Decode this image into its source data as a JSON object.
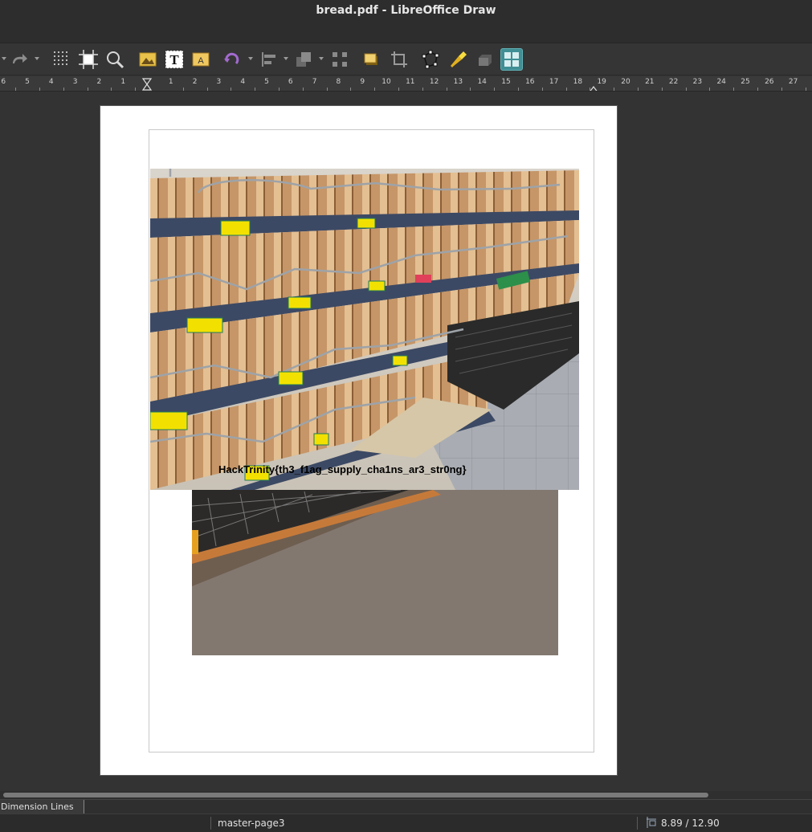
{
  "window": {
    "title": "bread.pdf - LibreOffice Draw"
  },
  "toolbar": {
    "items": [
      "redo-icon",
      "grid-icon",
      "helplines-icon",
      "zoom-icon",
      "image-icon",
      "text-box-icon",
      "fontwork-icon",
      "rotate-icon",
      "align-icon",
      "arrange-icon",
      "distribute-icon",
      "shadow-icon",
      "crop-icon",
      "points-icon",
      "glue-points-icon",
      "toggle-extrusion-icon",
      "display-views-icon"
    ]
  },
  "ruler": {
    "labels": [
      "6",
      "5",
      "4",
      "3",
      "2",
      "1",
      "1",
      "2",
      "3",
      "4",
      "5",
      "6",
      "7",
      "8",
      "9",
      "10",
      "11",
      "12",
      "13",
      "14",
      "15",
      "16",
      "17",
      "18",
      "19",
      "20",
      "21",
      "22",
      "23",
      "24",
      "25",
      "26",
      "27"
    ]
  },
  "document": {
    "flag_text": "HackTrinity{th3_f1ag_supply_cha1ns_ar3_str0ng}"
  },
  "tabs": {
    "active": "Dimension Lines"
  },
  "statusbar": {
    "master_page": "master-page3",
    "position": "8.89 / 12.90"
  },
  "colors": {
    "active_tool": "#3f8f94",
    "shelf_label": "#f5e400",
    "shelf_rail": "#3a4a66"
  }
}
